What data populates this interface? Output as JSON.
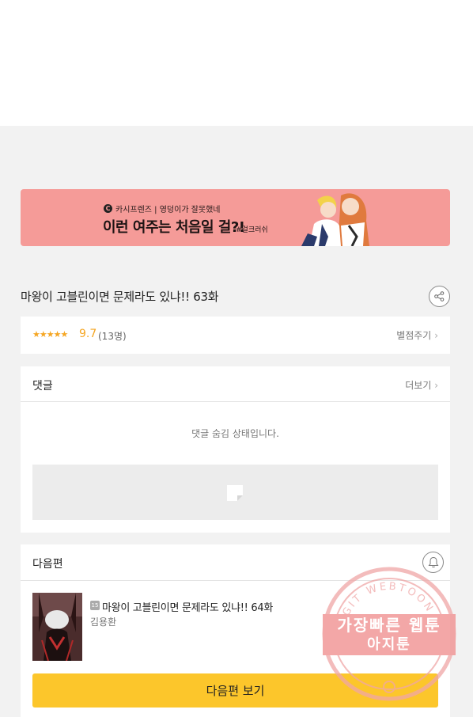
{
  "banner": {
    "brand": "카시프렌즈 | 영덩이가 잘못했네",
    "headline": "이런 여주는 처음일 걸?!",
    "tag": "#걸크러쉬"
  },
  "episode": {
    "title": "마왕이 고블린이면 문제라도 있냐!! 63화"
  },
  "rating": {
    "stars": "★★★★★",
    "score": "9.7",
    "count": "(13명)",
    "rate_label": "별점주기"
  },
  "comments": {
    "label": "댓글",
    "more": "더보기",
    "hidden_message": "댓글 숨김 상태입니다."
  },
  "next": {
    "label": "다음편",
    "age": "15",
    "title": "마왕이 고블린이면 문제라도 있냐!! 64화",
    "author": "김용환",
    "button": "다음편 보기"
  },
  "watermark": {
    "arc_text": "AGIT WEBTOON",
    "line1": "가장빠른 웹툰",
    "line2": "아지툰"
  },
  "colors": {
    "accent_yellow": "#fcc62b",
    "rating_orange": "#f5a623",
    "banner_pink": "#f59b98"
  }
}
